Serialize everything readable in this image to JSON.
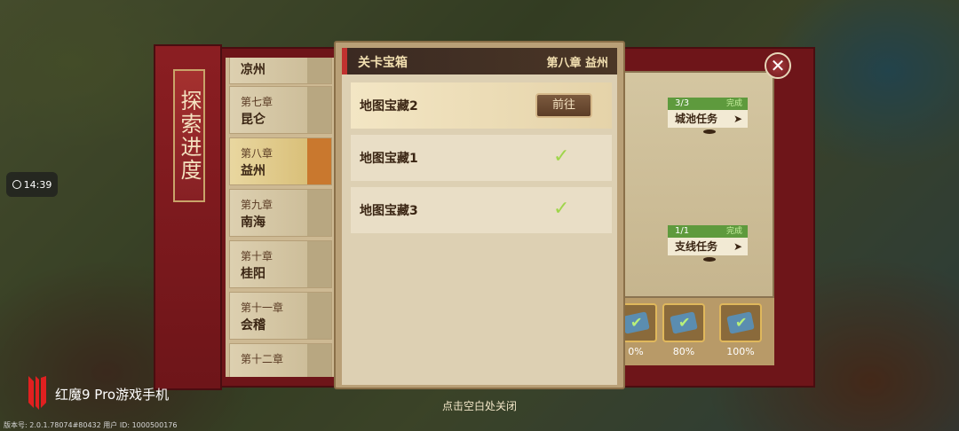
{
  "time": "14:39",
  "explore_panel": {
    "title": "探索进度"
  },
  "chapters": [
    {
      "num": "",
      "name": "凉州"
    },
    {
      "num": "第七章",
      "name": "昆仑"
    },
    {
      "num": "第八章",
      "name": "益州",
      "active": true
    },
    {
      "num": "第九章",
      "name": "南海"
    },
    {
      "num": "第十章",
      "name": "桂阳"
    },
    {
      "num": "第十一章",
      "name": "会稽"
    },
    {
      "num": "第十二章",
      "name": ""
    }
  ],
  "modal": {
    "title": "关卡宝箱",
    "chapter": "第八章  益州",
    "items": [
      {
        "name": "地图宝藏2",
        "action": "前往",
        "completed": false
      },
      {
        "name": "地图宝藏1",
        "completed": true
      },
      {
        "name": "地图宝藏3",
        "completed": true
      }
    ]
  },
  "tasks": [
    {
      "count": "3/3",
      "status": "完成",
      "label": "城池任务"
    },
    {
      "count": "1/1",
      "status": "完成",
      "label": "支线任务"
    }
  ],
  "rewards": [
    {
      "pct": "0%"
    },
    {
      "pct": "80%"
    },
    {
      "pct": "100%"
    }
  ],
  "close_hint": "点击空白处关闭",
  "watermark": {
    "text": "红魔9 Pro游戏手机"
  },
  "version": "版本号: 2.0.1.78074#80432 用户 ID: 1000500176"
}
